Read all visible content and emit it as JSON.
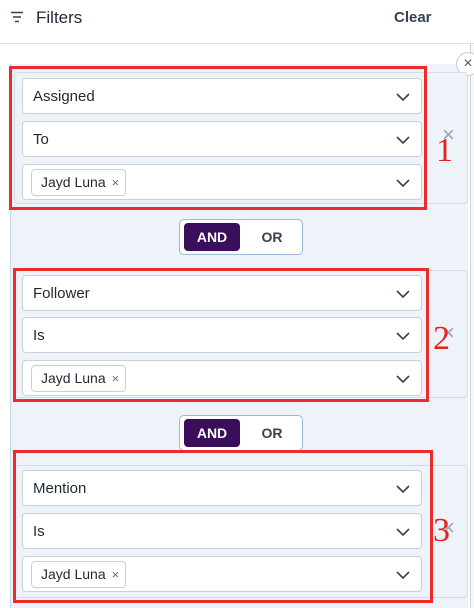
{
  "header": {
    "title": "Filters",
    "clear_label": "Clear"
  },
  "groups": [
    {
      "field": "Assigned",
      "operator": "To",
      "value": "Jayd Luna",
      "number": "1"
    },
    {
      "field": "Follower",
      "operator": "Is",
      "value": "Jayd Luna",
      "number": "2"
    },
    {
      "field": "Mention",
      "operator": "Is",
      "value": "Jayd Luna",
      "number": "3"
    }
  ],
  "connectors": [
    {
      "and_label": "AND",
      "or_label": "OR",
      "selected": "AND"
    },
    {
      "and_label": "AND",
      "or_label": "OR",
      "selected": "AND"
    }
  ],
  "icons": {
    "remove": "×",
    "chip_remove": "×",
    "close": "×"
  },
  "colors": {
    "and_active": "#3a0e5a",
    "annotation_red": "#ee2a2a"
  }
}
